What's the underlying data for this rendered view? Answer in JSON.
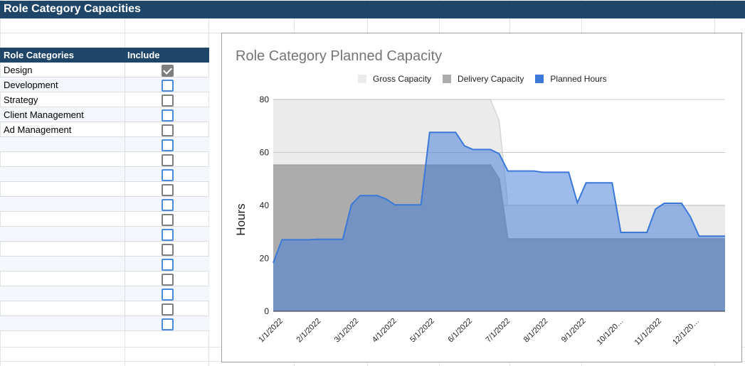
{
  "sheet": {
    "title": "Role Category Capacities",
    "table_headers": [
      "Role Categories",
      "Include"
    ],
    "rows": [
      {
        "name": "Design",
        "checked": true
      },
      {
        "name": "Development",
        "checked": false
      },
      {
        "name": "Strategy",
        "checked": false
      },
      {
        "name": "Client Management",
        "checked": false
      },
      {
        "name": "Ad Management",
        "checked": false
      },
      {
        "name": "",
        "checked": false
      },
      {
        "name": "",
        "checked": false
      },
      {
        "name": "",
        "checked": false
      },
      {
        "name": "",
        "checked": false
      },
      {
        "name": "",
        "checked": false
      },
      {
        "name": "",
        "checked": false
      },
      {
        "name": "",
        "checked": false
      },
      {
        "name": "",
        "checked": false
      },
      {
        "name": "",
        "checked": false
      },
      {
        "name": "",
        "checked": false
      },
      {
        "name": "",
        "checked": false
      },
      {
        "name": "",
        "checked": false
      },
      {
        "name": "",
        "checked": false
      }
    ],
    "accent_color": "#1f4568"
  },
  "chart_data": {
    "type": "area",
    "title": "Role Category Planned Capacity",
    "xlabel": "",
    "ylabel": "Hours",
    "ylim": [
      0,
      80
    ],
    "yticks": [
      0,
      20,
      40,
      60,
      80
    ],
    "grid": true,
    "legend_position": "top",
    "x_tick_labels": [
      "1/1/2022",
      "2/1/2022",
      "3/1/2022",
      "4/1/2022",
      "5/1/2022",
      "6/1/2022",
      "7/1/2022",
      "8/1/2022",
      "9/1/2022",
      "10/1/20…",
      "11/1/20​22",
      "12/1/20…"
    ],
    "x_interval": "weekly from 1/1/2022",
    "series": [
      {
        "name": "Gross Capacity",
        "color": "#ebebeb",
        "values": [
          80,
          80,
          80,
          80,
          80,
          80,
          80,
          80,
          80,
          80,
          80,
          80,
          80,
          80,
          80,
          80,
          80,
          80,
          80,
          80,
          80,
          80,
          80,
          80,
          80,
          80,
          72,
          40,
          40,
          40,
          40,
          40,
          40,
          40,
          40,
          40,
          40,
          40,
          40,
          40,
          40,
          40,
          40,
          40,
          40,
          40,
          40,
          40,
          40,
          40,
          40,
          40,
          40
        ]
      },
      {
        "name": "Delivery Capacity",
        "color": "#acacac",
        "values": [
          55.2,
          55.2,
          55.2,
          55.2,
          55.2,
          55.2,
          55.2,
          55.2,
          55.2,
          55.2,
          55.2,
          55.2,
          55.2,
          55.2,
          55.2,
          55.2,
          55.2,
          55.2,
          55.2,
          55.2,
          55.2,
          55.2,
          55.2,
          55.2,
          55.2,
          55.2,
          50,
          27.3,
          27.3,
          27.3,
          27.3,
          27.3,
          27.3,
          27.3,
          27.3,
          27.3,
          27.3,
          27.3,
          27.3,
          27.3,
          27.3,
          27.3,
          27.3,
          27.3,
          27.3,
          27.3,
          27.3,
          27.3,
          27.3,
          27.3,
          27.3,
          27.3,
          27.3
        ]
      },
      {
        "name": "Planned Hours",
        "color": "#3c78d8",
        "values": [
          18.3,
          27,
          27,
          27,
          27,
          27.2,
          27.2,
          27.2,
          27.2,
          40.3,
          43.7,
          43.7,
          43.7,
          42.4,
          40.2,
          40.2,
          40.2,
          40.2,
          67.6,
          67.6,
          67.6,
          67.6,
          62.5,
          61.1,
          61.1,
          61.1,
          59.5,
          53,
          53,
          53,
          53,
          52.5,
          52.5,
          52.5,
          52.5,
          41,
          48.5,
          48.5,
          48.5,
          48.5,
          29.8,
          29.8,
          29.8,
          29.8,
          38.6,
          40.8,
          40.8,
          40.8,
          35.7,
          28.4,
          28.4,
          28.4,
          28.4
        ]
      }
    ]
  }
}
